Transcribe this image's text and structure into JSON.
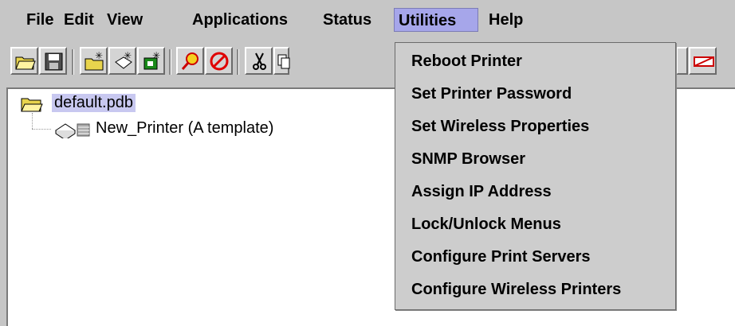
{
  "menubar": {
    "items": [
      {
        "label": "File"
      },
      {
        "label": "Edit"
      },
      {
        "label": "View"
      },
      {
        "label": "Applications"
      },
      {
        "label": "Status"
      },
      {
        "label": "Utilities"
      },
      {
        "label": "Help"
      }
    ],
    "active_label": "Utilities"
  },
  "toolbar": {
    "buttons": [
      {
        "icon": "open-folder-icon"
      },
      {
        "icon": "save-icon"
      },
      {
        "icon": "new-folder-icon"
      },
      {
        "icon": "new-printer-icon"
      },
      {
        "icon": "new-printer-group-icon"
      },
      {
        "icon": "find-icon"
      },
      {
        "icon": "stop-icon"
      },
      {
        "icon": "cut-icon"
      },
      {
        "icon": "copy-icon"
      },
      {
        "icon": "printer-icon"
      },
      {
        "icon": "delete-icon"
      }
    ]
  },
  "tree": {
    "root": {
      "label": "default.pdb",
      "icon": "folder-icon"
    },
    "children": [
      {
        "label": "New_Printer (A template)",
        "icon": "printer-icon"
      }
    ]
  },
  "utilities_menu": {
    "items": [
      {
        "label": "Reboot Printer"
      },
      {
        "label": "Set Printer Password"
      },
      {
        "label": "Set Wireless Properties"
      },
      {
        "label": "SNMP Browser"
      },
      {
        "label": "Assign IP Address"
      },
      {
        "label": "Lock/Unlock Menus"
      },
      {
        "label": "Configure Print Servers"
      },
      {
        "label": "Configure Wireless Printers"
      }
    ]
  },
  "colors": {
    "background": "#c6c6c6",
    "menu_highlight": "#a6a6ea",
    "tree_selection": "#c8c8f0",
    "stop_red": "#e00000"
  }
}
